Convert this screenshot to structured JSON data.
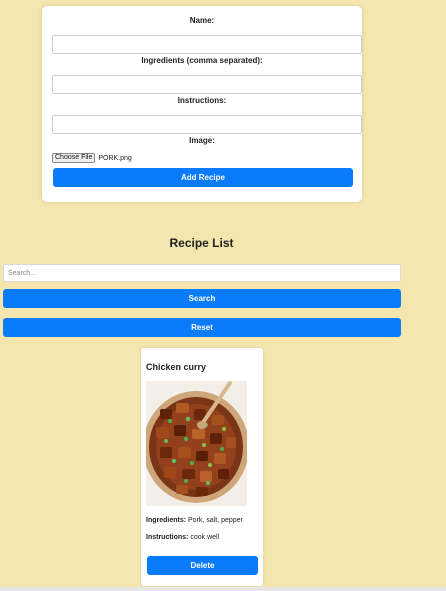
{
  "form": {
    "name_label": "Name:",
    "ingredients_label": "Ingredients (comma separated):",
    "instructions_label": "Instructions:",
    "image_label": "Image:",
    "choose_file_label": "Choose File",
    "file_name": "PORK.png",
    "add_button_label": "Add Recipe"
  },
  "list": {
    "title": "Recipe List",
    "search_placeholder": "Search...",
    "search_button_label": "Search",
    "reset_button_label": "Reset"
  },
  "recipes": [
    {
      "title": "Chicken curry",
      "ingredients_label": "Ingredients:",
      "ingredients": "Pork, salt, pepper",
      "instructions_label": "Instructions:",
      "instructions": "cook well",
      "delete_label": "Delete"
    }
  ],
  "colors": {
    "background": "#f5e5ae",
    "accent": "#0a7bfa"
  }
}
